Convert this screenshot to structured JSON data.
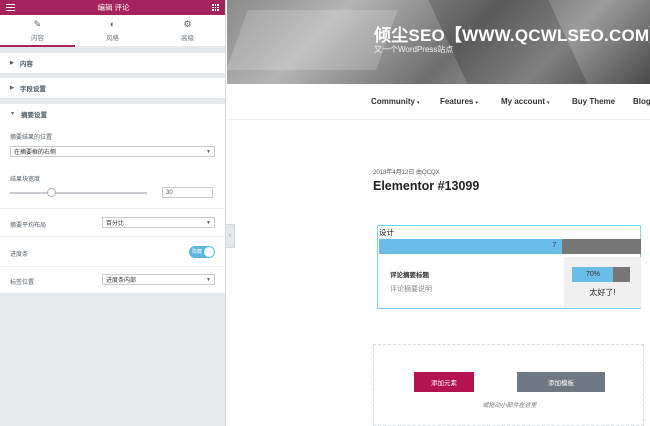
{
  "panel": {
    "header_title": "编辑 评论",
    "tabs": [
      {
        "label": "内容",
        "icon": "pencil-icon",
        "active": true
      },
      {
        "label": "风格",
        "icon": "half-circle-icon",
        "active": false
      },
      {
        "label": "高级",
        "icon": "gear-icon",
        "active": false
      }
    ],
    "sections": {
      "content": "内容",
      "field_settings": "字段设置",
      "summary_settings": "摘要设置"
    },
    "controls": {
      "summary_position_label": "摘要结果的位置",
      "summary_position_value": "在摘要框的右侧",
      "result_width_label": "结果块宽度",
      "result_width_value": "30",
      "result_width_fraction": 0.3,
      "average_layout_label": "摘要平均布局",
      "average_layout_value": "百分比",
      "progress_bar_label": "进度条",
      "progress_bar_toggle": "隐藏",
      "progress_bar_on": true,
      "label_position_label": "标签位置",
      "label_position_value": "进度条内部"
    },
    "accent_color": "#a4235c"
  },
  "site": {
    "title": "倾尘SEO【WWW.QCWLSEO.COM】",
    "description": "又一个WordPress站点",
    "nav": [
      {
        "label": "Community",
        "dropdown": true
      },
      {
        "label": "Features",
        "dropdown": true
      },
      {
        "label": "My account",
        "dropdown": true
      },
      {
        "label": "Buy Theme",
        "dropdown": false
      },
      {
        "label": "Blog",
        "dropdown": false
      }
    ],
    "post_meta": "2018年4月12日 由QCQX",
    "post_title": "Elementor #13099"
  },
  "review": {
    "criteria_title": "设计",
    "criteria_score": "7",
    "criteria_fraction": 0.7,
    "summary_title": "评论摘要标题",
    "summary_desc": "评论摘要说明",
    "percent_text": "70%",
    "percent_fraction": 0.7,
    "verdict": "太好了!",
    "bar_color": "#6abde6"
  },
  "add_section": {
    "add_button": "添加元素",
    "template_button": "添加模板",
    "hint": "或拖动小部件在这里"
  }
}
